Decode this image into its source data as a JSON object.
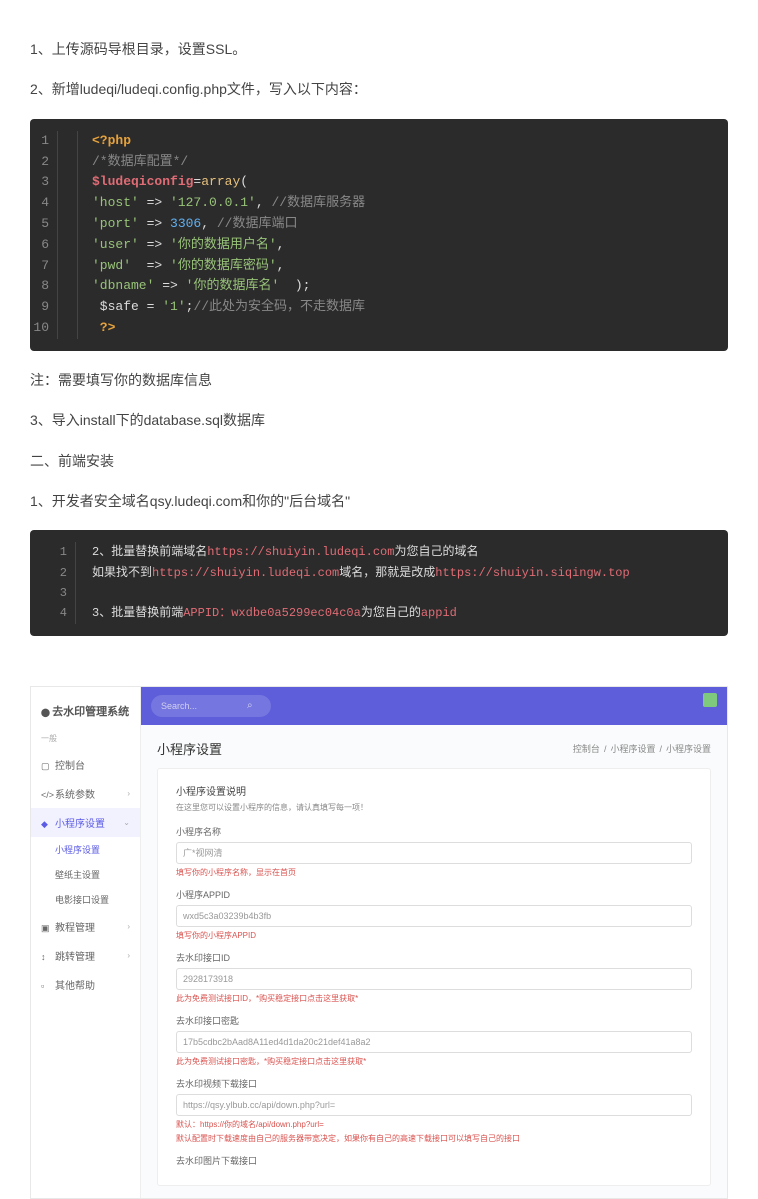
{
  "steps": {
    "s1": "1、上传源码导根目录，设置SSL。",
    "s2": "2、新增ludeqi/ludeqi.config.php文件，写入以下内容：",
    "note": "注：需要填写你的数据库信息",
    "s3": "3、导入install下的database.sql数据库",
    "h2": "二、前端安装",
    "s4": "1、开发者安全域名qsy.ludeqi.com和你的\"后台域名\""
  },
  "code1": {
    "l1a": "<?php",
    "l2": "/*数据库配置*/",
    "l3a": "$ludeqiconfig",
    "l3b": "=",
    "l3c": "array",
    "l3d": "(",
    "l4a": "'host'",
    "l4b": " => ",
    "l4c": "'127.0.0.1'",
    "l4d": ", ",
    "l4e": "//数据库服务器",
    "l5a": "'port'",
    "l5b": " => ",
    "l5c": "3306",
    "l5d": ", ",
    "l5e": "//数据库端口",
    "l6a": "'user'",
    "l6b": " => ",
    "l6c": "'你的数据用户名'",
    "l6d": ",",
    "l7a": "'pwd'",
    "l7b": "  => ",
    "l7c": "'你的数据库密码'",
    "l7d": ",",
    "l8a": "'dbname'",
    "l8b": " => ",
    "l8c": "'你的数据库名'",
    "l8d": "  );",
    "l9a": " $safe = ",
    "l9b": "'1'",
    "l9c": ";",
    "l9d": "//此处为安全码，不走数据库",
    "l10": " ?>"
  },
  "code2": {
    "r1a": "2、批量替换前端域名",
    "r1b": "https://shuiyin.ludeqi.com",
    "r1c": "为您自己的域名",
    "r2a": "如果找不到",
    "r2b": "https://shuiyin.ludeqi.com",
    "r2c": "域名，那就是改成",
    "r2d": "https://shuiyin.siqingw.top",
    "r4a": "3、批量替换前端",
    "r4b": "APPID：wxdbe0a5299ec04c0a",
    "r4c": "为您自己的",
    "r4d": "appid"
  },
  "admin": {
    "brand": "去水印管理系统",
    "search_ph": "Search...",
    "sidebar": {
      "group0": "一般",
      "console": "控制台",
      "sysparam": "系统参数",
      "minip": "小程序设置",
      "minip_set": "小程序设置",
      "wallpaper": "壁纸主设置",
      "movie": "电影接口设置",
      "tutorial": "教程管理",
      "jump": "跳转管理",
      "other": "其他帮助"
    },
    "page": {
      "title": "小程序设置",
      "crumb1": "控制台",
      "crumb2": "小程序设置",
      "crumb3": "小程序设置"
    },
    "form": {
      "desc_t": "小程序设置说明",
      "desc_s": "在这里您可以设置小程序的信息，请认真填写每一项！",
      "name_l": "小程序名称",
      "name_v": "广*视网清",
      "name_h": "填写你的小程序名称，显示在首页",
      "appid_l": "小程序APPID",
      "appid_v": "wxd5c3a03239b4b3fb",
      "appid_h": "填写你的小程序APPID",
      "qsy_id_l": "去水印接口ID",
      "qsy_id_v": "2928173918",
      "qsy_id_h": "此为免费测试接口ID，*购买稳定接口点击这里获取*",
      "qsy_key_l": "去水印接口密匙",
      "qsy_key_v": "17b5cdbc2bAad8A11ed4d1da20c21def41a8a2",
      "qsy_key_h": "此为免费测试接口密匙，*购买稳定接口点击这里获取*",
      "vdl_l": "去水印视频下载接口",
      "vdl_v": "https://qsy.ylbub.cc/api/down.php?url=",
      "vdl_h1": "默认：https://你的域名/api/down.php?url=",
      "vdl_h2": "默认配置时下载速度由自己的服务器带宽决定，如果你有自己的高速下载接口可以填写自己的接口",
      "pdl_l": "去水印图片下载接口"
    }
  }
}
